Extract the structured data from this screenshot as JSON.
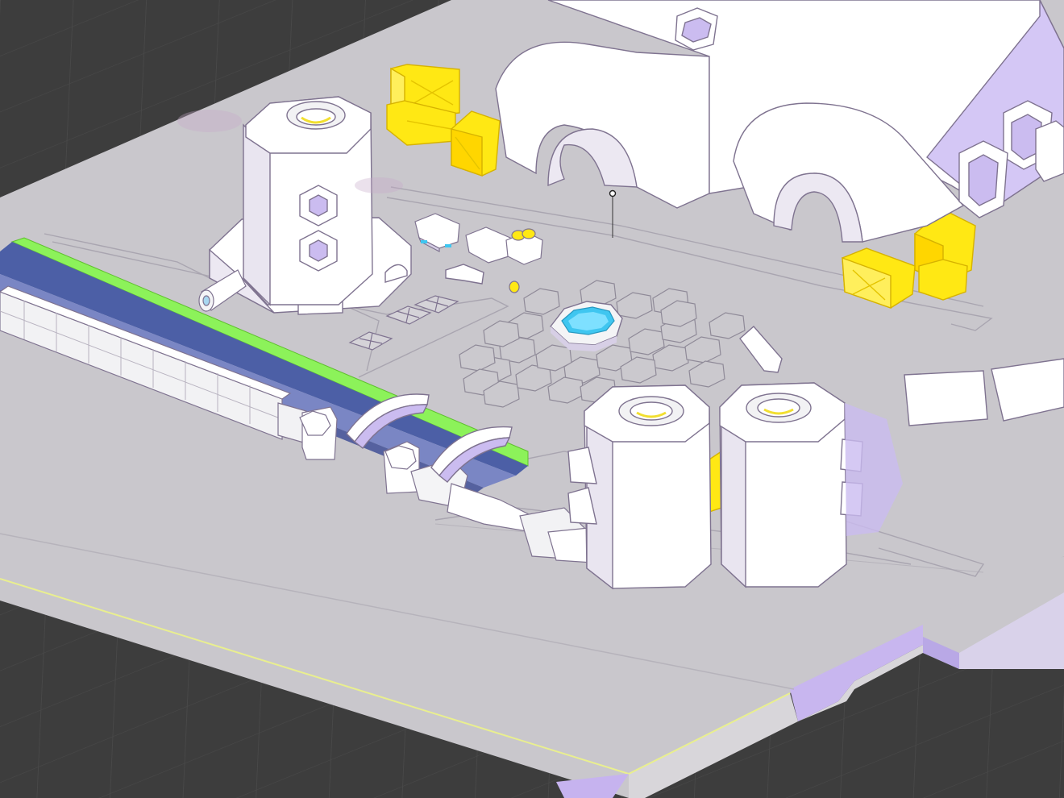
{
  "scene": {
    "view": "3d-viewport",
    "colors": {
      "background": "#3d3d3d",
      "grid": "#4a4a4a",
      "ground": "#c9c7cc",
      "ground_side": "#d8d6da",
      "ground_shadow": "#b9a8e6",
      "building": "#ffffff",
      "building_shadow": "#cbbcf0",
      "crate": "#ffe814",
      "crate_dark": "#e4c400",
      "rail_green": "#8cf25a",
      "rail_blue": "#4c5fa6",
      "water": "#3fc6f0",
      "outline": "#7f7390"
    },
    "objects": [
      {
        "name": "storage-silo-left",
        "kind": "silo"
      },
      {
        "name": "hangar-domes",
        "kind": "hangar"
      },
      {
        "name": "crate-stack-top",
        "kind": "crates"
      },
      {
        "name": "crate-stack-right",
        "kind": "crates"
      },
      {
        "name": "mine-carts",
        "kind": "carts",
        "count": 3
      },
      {
        "name": "hex-plaza-fountain",
        "kind": "fountain"
      },
      {
        "name": "twin-tanks",
        "kind": "tanks"
      },
      {
        "name": "rail-track",
        "kind": "rail"
      },
      {
        "name": "perimeter-wall",
        "kind": "wall"
      },
      {
        "name": "arch-bridges",
        "kind": "bridges",
        "count": 2
      },
      {
        "name": "loose-panels",
        "kind": "panels",
        "count": 2
      }
    ]
  }
}
